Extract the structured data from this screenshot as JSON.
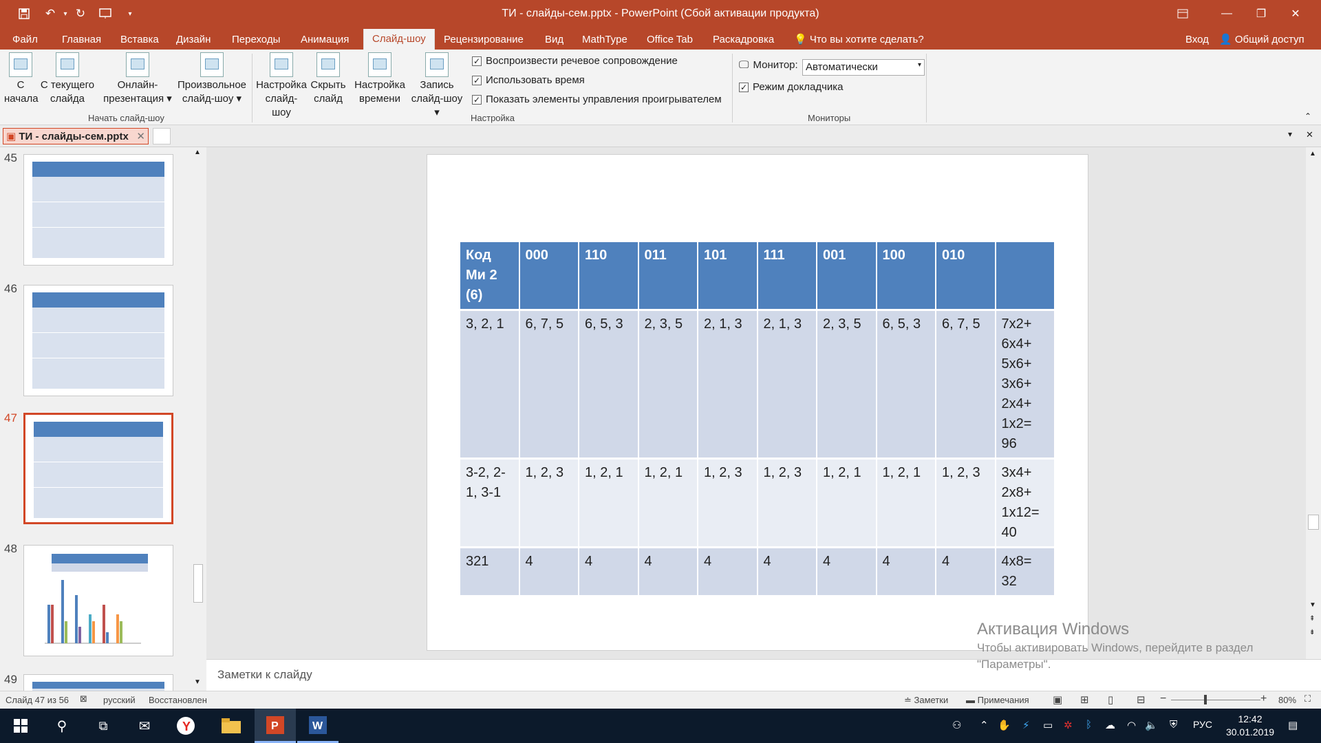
{
  "window": {
    "title": "ТИ - слайды-сем.pptx - PowerPoint (Сбой активации продукта)",
    "sign_in": "Вход",
    "share": "Общий доступ"
  },
  "tabs": [
    "Файл",
    "Главная",
    "Вставка",
    "Дизайн",
    "Переходы",
    "Анимация",
    "Слайд-шоу",
    "Рецензирование",
    "Вид",
    "MathType",
    "Office Tab",
    "Раскадровка"
  ],
  "active_tab": "Слайд-шоу",
  "tell_me": "Что вы хотите сделать?",
  "ribbon": {
    "start_group": {
      "label": "Начать слайд-шоу",
      "buttons": [
        {
          "line1": "С",
          "line2": "начала"
        },
        {
          "line1": "С текущего",
          "line2": "слайда"
        },
        {
          "line1": "Онлайн-",
          "line2": "презентация ▾"
        },
        {
          "line1": "Произвольное",
          "line2": "слайд-шоу ▾"
        }
      ]
    },
    "setup_group": {
      "label": "Настройка",
      "buttons": [
        {
          "line1": "Настройка",
          "line2": "слайд-шоу"
        },
        {
          "line1": "Скрыть",
          "line2": "слайд"
        },
        {
          "line1": "Настройка",
          "line2": "времени"
        },
        {
          "line1": "Запись",
          "line2": "слайд-шоу ▾"
        }
      ],
      "checkboxes": [
        {
          "label": "Воспроизвести речевое сопровождение",
          "checked": true
        },
        {
          "label": "Использовать время",
          "checked": true
        },
        {
          "label": "Показать элементы управления проигрывателем",
          "checked": true
        }
      ]
    },
    "monitors_group": {
      "label": "Мониторы",
      "monitor_label": "Монитор:",
      "monitor_value": "Автоматически",
      "presenter_view": "Режим докладчика"
    }
  },
  "doc_tab": "ТИ - слайды-сем.pptx",
  "thumbnails": [
    "45",
    "46",
    "47",
    "48",
    "49"
  ],
  "selected_slide": "47",
  "slide_table": {
    "header": [
      "Код\nМи 2\n(6)",
      "000",
      "110",
      "011",
      "101",
      "111",
      "001",
      "100",
      "010",
      ""
    ],
    "rows": [
      [
        "3, 2, 1",
        "6, 7, 5",
        "6, 5, 3",
        "2, 3, 5",
        "2, 1, 3",
        "2, 1, 3",
        "2, 3, 5",
        "6, 5, 3",
        "6, 7, 5",
        "7х2+\n6х4+\n5х6+\n3х6+\n2х4+\n1х2=\n96"
      ],
      [
        "3-2, 2-\n1, 3-1",
        "1, 2, 3",
        "1, 2, 1",
        "1, 2, 1",
        "1, 2, 3",
        "1, 2, 3",
        "1, 2, 1",
        "1, 2, 1",
        "1, 2, 3",
        "3х4+\n2х8+\n1х12=\n40"
      ],
      [
        "321",
        "4",
        "4",
        "4",
        "4",
        "4",
        "4",
        "4",
        "4",
        "4х8=\n32"
      ]
    ]
  },
  "notes_placeholder": "Заметки к слайду",
  "activation": {
    "title": "Активация Windows",
    "text": "Чтобы активировать Windows, перейдите в раздел \"Параметры\"."
  },
  "status": {
    "slide": "Слайд 47 из 56",
    "language": "русский",
    "state": "Восстановлен",
    "notes": "Заметки",
    "comments": "Примечания",
    "zoom": "80%"
  },
  "taskbar": {
    "lang": "РУС",
    "time": "12:42",
    "date": "30.01.2019"
  }
}
